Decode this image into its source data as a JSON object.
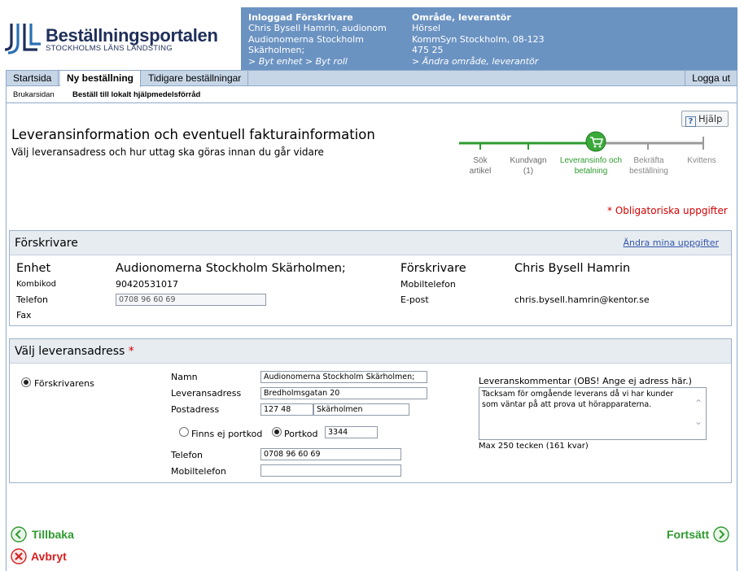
{
  "header": {
    "logo_title": "Beställningsportalen",
    "logo_subtitle": "STOCKHOLMS LÄNS LANDSTING",
    "prescriber": {
      "heading": "Inloggad Förskrivare",
      "lines": [
        "Chris Bysell Hamrin, audionom",
        "Audionomerna Stockholm",
        "Skärholmen;"
      ],
      "links": "> Byt enhet > Byt roll"
    },
    "area": {
      "heading": "Område, leverantör",
      "lines": [
        "Hörsel",
        "KommSyn Stockholm, 08-123",
        "475 25"
      ],
      "links": "> Ändra område, leverantör"
    }
  },
  "tabs": [
    {
      "label": "Startsida",
      "active": false
    },
    {
      "label": "Ny beställning",
      "active": true
    },
    {
      "label": "Tidigare beställningar",
      "active": false
    }
  ],
  "logout_label": "Logga ut",
  "breadcrumb": [
    "Brukarsidan",
    "Beställ till lokalt hjälpmedelsförråd"
  ],
  "help_label": "Hjälp",
  "page_title": "Leveransinformation och eventuell fakturainformation",
  "page_subtitle": "Välj leveransadress och hur uttag ska göras innan du går vidare",
  "progress": {
    "steps": [
      {
        "label": [
          "Sök",
          "artikel"
        ],
        "state": "done"
      },
      {
        "label": [
          "Kundvagn",
          "(1)"
        ],
        "state": "done"
      },
      {
        "label": [
          "Leveransinfo och",
          "betalning"
        ],
        "state": "current"
      },
      {
        "label": [
          "Bekräfta",
          "beställning"
        ],
        "state": "todo"
      },
      {
        "label": [
          "Kvittens"
        ],
        "state": "todo"
      }
    ],
    "colors": {
      "done": "#2e9a2e",
      "todo": "#9a9a9a"
    }
  },
  "mandatory_note": "* Obligatoriska uppgifter",
  "prescriber_section": {
    "title": "Förskrivare",
    "edit_link": "Ändra mina uppgifter",
    "enhet_label": "Enhet",
    "enhet_value": "Audionomerna Stockholm Skärholmen;",
    "kombikod_label": "Kombikod",
    "kombikod_value": "90420531017",
    "telefon_label": "Telefon",
    "telefon_value": "0708 96 60 69",
    "fax_label": "Fax",
    "forskrivare_label": "Förskrivare",
    "forskrivare_value": "Chris Bysell Hamrin",
    "mobil_label": "Mobiltelefon",
    "epost_label": "E-post",
    "epost_value": "chris.bysell.hamrin@kentor.se"
  },
  "delivery_section": {
    "title": "Välj leveransadress",
    "required_mark": "*",
    "option_label": "Förskrivarens",
    "namn_label": "Namn",
    "namn_value": "Audionomerna Stockholm Skärholmen;",
    "leveransadress_label": "Leveransadress",
    "leveransadress_value": "Bredholmsgatan 20",
    "postadress_label": "Postadress",
    "postnummer_value": "127 48",
    "ort_value": "Skärholmen",
    "no_portkod_label": "Finns ej portkod",
    "portkod_label": "Portkod",
    "portkod_value": "3344",
    "telefon_label": "Telefon",
    "telefon_value": "0708 96 60 69",
    "mobil_label": "Mobiltelefon",
    "mobil_value": "",
    "comment_label": "Leveranskommentar (OBS! Ange ej adress här.)",
    "comment_value": "Tacksam för omgående leverans då vi har kunder som väntar på att prova ut hörapparaterna.",
    "comment_limit": "Max 250 tecken (161 kvar)"
  },
  "nav": {
    "back_label": "Tillbaka",
    "cancel_label": "Avbryt",
    "continue_label": "Fortsätt"
  },
  "colors": {
    "header_panel": "#6b93c2",
    "link_blue": "#3355aa",
    "success_green": "#2e9a2e",
    "cancel_red": "#d42020"
  }
}
